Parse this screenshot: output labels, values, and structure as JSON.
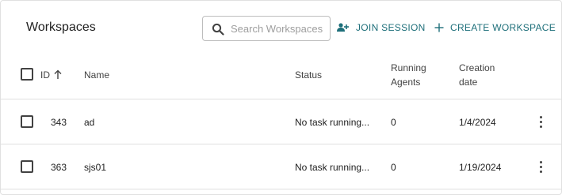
{
  "header": {
    "title": "Workspaces",
    "search_placeholder": "Search Workspaces",
    "join_label": "JOIN SESSION",
    "create_label": "CREATE WORKSPACE"
  },
  "table": {
    "columns": {
      "id": "ID",
      "name": "Name",
      "status": "Status",
      "agents_line1": "Running",
      "agents_line2": "Agents",
      "date_line1": "Creation",
      "date_line2": "date"
    },
    "sort": {
      "column": "ID",
      "direction": "ascending"
    },
    "rows": [
      {
        "id": "343",
        "name": "ad",
        "status": "No task running...",
        "agents": "0",
        "date": "1/4/2024"
      },
      {
        "id": "363",
        "name": "sjs01",
        "status": "No task running...",
        "agents": "0",
        "date": "1/19/2024"
      }
    ]
  },
  "colors": {
    "accent": "#1e6f7a",
    "border": "#e0e0e0",
    "text": "#212121"
  },
  "icons": [
    "search-icon",
    "join-session-icon",
    "plus-icon",
    "sort-arrow-up-icon",
    "more-vertical-icon"
  ]
}
